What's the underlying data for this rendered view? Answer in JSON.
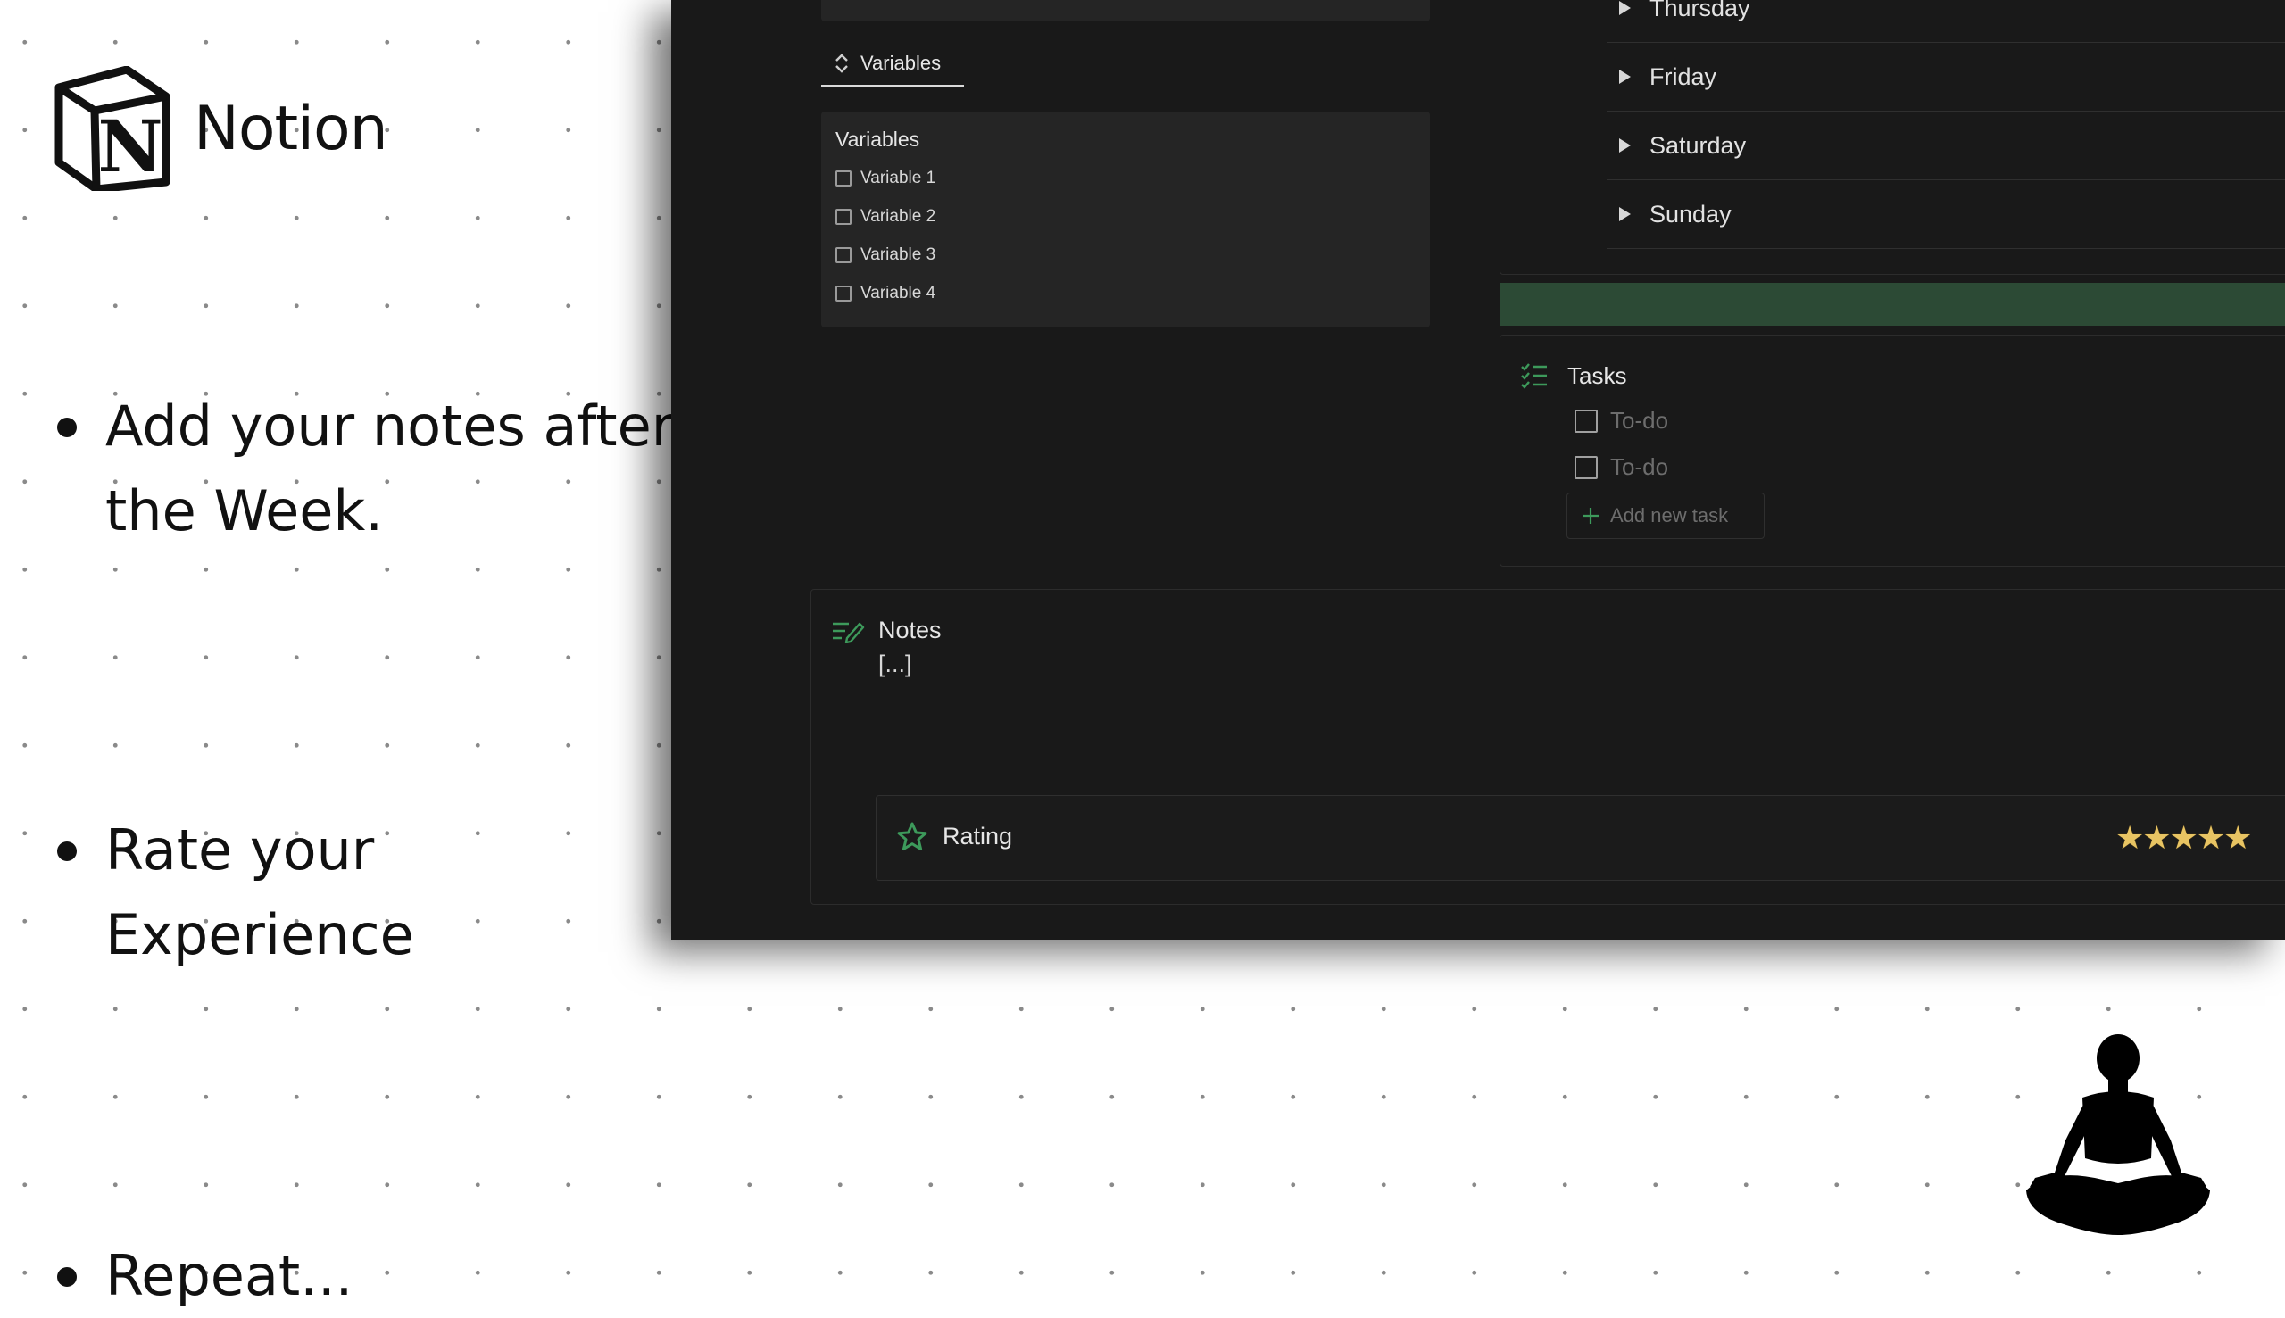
{
  "brand": {
    "name": "Notion",
    "logo_icon": "notion-logo-icon"
  },
  "bullets": [
    {
      "text": "Add your notes after the Week."
    },
    {
      "text": "Rate your Experience"
    },
    {
      "text": "Repeat..."
    }
  ],
  "app": {
    "tab": {
      "label": "Variables",
      "icon": "chevron-up-down-icon"
    },
    "variables": {
      "title": "Variables",
      "items": [
        "Variable 1",
        "Variable 2",
        "Variable 3",
        "Variable 4"
      ]
    },
    "days": [
      "Thursday",
      "Friday",
      "Saturday",
      "Sunday"
    ],
    "tasks": {
      "title": "Tasks",
      "icon": "checklist-icon",
      "items": [
        "To-do",
        "To-do"
      ],
      "add_label": "Add new task"
    },
    "notes": {
      "title": "Notes",
      "icon": "edit-lines-icon",
      "body": "[...]"
    },
    "rating": {
      "label": "Rating",
      "icon": "star-outline-icon",
      "stars": "★★★★★",
      "value": 5
    }
  },
  "colors": {
    "accent_green": "#3d9a5b",
    "green_bar": "#2c4a35",
    "panel": "#191919",
    "star": "#e8c463"
  }
}
